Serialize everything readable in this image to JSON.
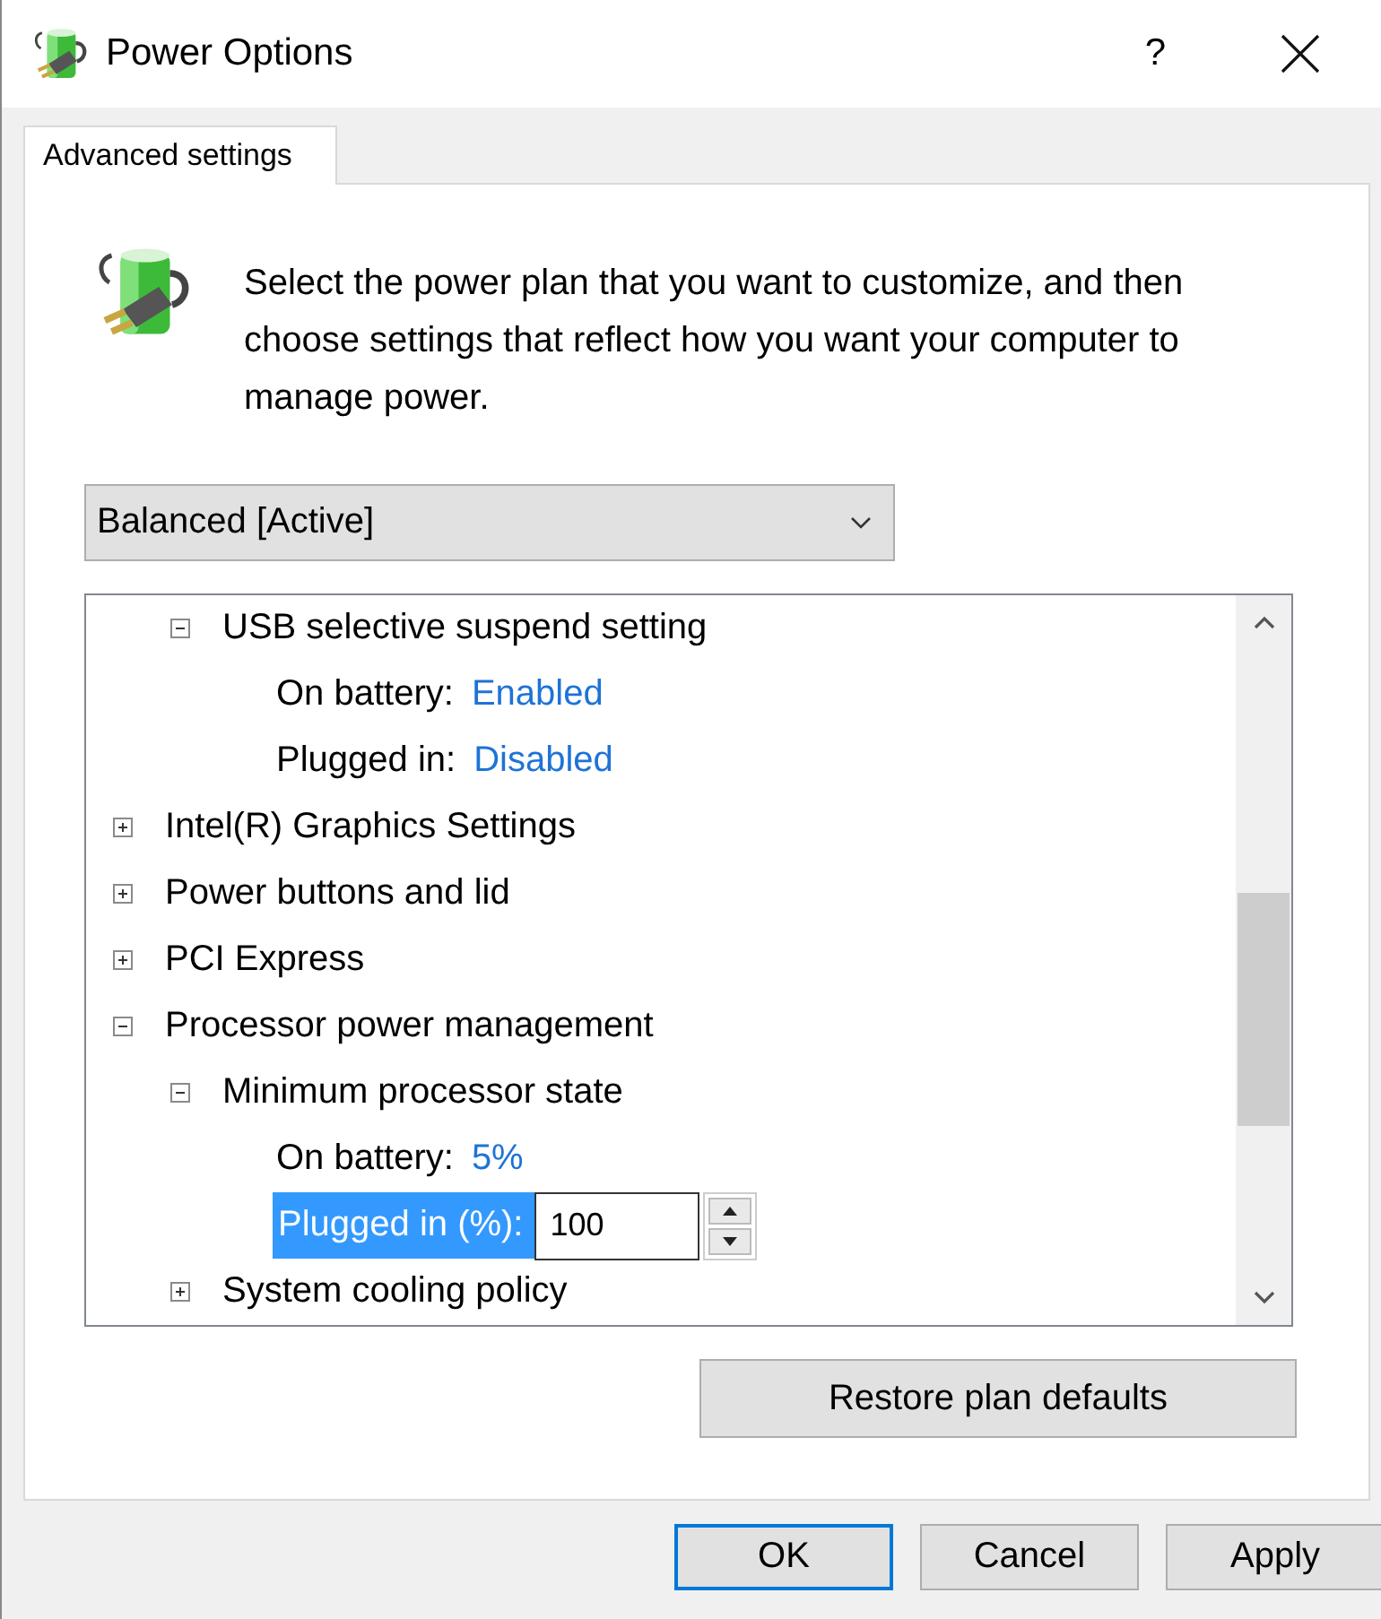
{
  "window": {
    "title": "Power Options",
    "help": "?"
  },
  "tabs": [
    {
      "label": "Advanced settings",
      "selected": true
    }
  ],
  "description": "Select the power plan that you want to customize, and then choose settings that reflect how you want your computer to manage power.",
  "plan_dropdown": {
    "value": "Balanced [Active]"
  },
  "settings_tree": [
    {
      "children": [
        {
          "kind": "node",
          "label": "USB selective suspend setting",
          "expanded": true,
          "selected": false,
          "children": [
            {
              "kind": "value",
              "label": "On battery:",
              "value": "Enabled",
              "selected": false
            },
            {
              "kind": "value",
              "label": "Plugged in:",
              "value": "Disabled",
              "selected": false
            }
          ]
        }
      ]
    },
    {
      "kind": "node",
      "label": "Intel(R) Graphics Settings",
      "expanded": false,
      "selected": false
    },
    {
      "kind": "node",
      "label": "Power buttons and lid",
      "expanded": false,
      "selected": false
    },
    {
      "kind": "node",
      "label": "PCI Express",
      "expanded": false,
      "selected": false
    },
    {
      "kind": "node",
      "label": "Processor power management",
      "expanded": true,
      "selected": false,
      "children": [
        {
          "kind": "node",
          "label": "Minimum processor state",
          "expanded": true,
          "selected": false,
          "children": [
            {
              "kind": "value",
              "label": "On battery:",
              "value": "5%",
              "selected": false
            },
            {
              "kind": "spin",
              "label": "Plugged in (%):",
              "value": "100",
              "selected": true
            }
          ]
        },
        {
          "kind": "node",
          "label": "System cooling policy",
          "expanded": false,
          "selected": false
        }
      ]
    }
  ],
  "restore_button": "Restore plan defaults",
  "buttons": [
    {
      "label": "OK",
      "default": true
    },
    {
      "label": "Cancel",
      "default": false
    },
    {
      "label": "Apply",
      "default": false
    }
  ]
}
